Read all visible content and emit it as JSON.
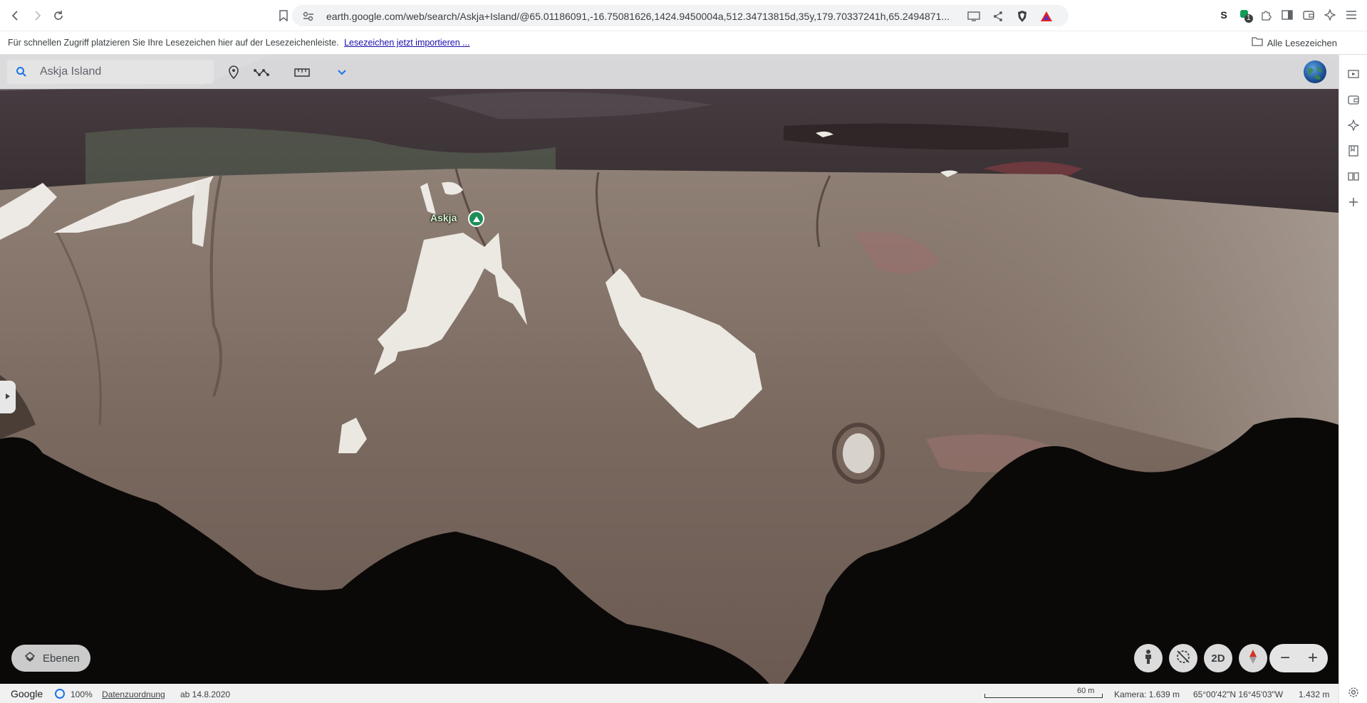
{
  "browser": {
    "url": "earth.google.com/web/search/Askja+Island/@65.01186091,-16.75081626,1424.9450004a,512.34713815d,35y,179.70337241h,65.2494871...",
    "icons": [
      "back-icon",
      "forward-icon",
      "reload-icon",
      "bookmark-icon",
      "site-settings-icon",
      "cast-icon",
      "share-icon",
      "brave-shield-icon",
      "brave-rewards-icon"
    ],
    "extensions": [
      "s-extension-icon",
      "ext-badge-icon",
      "puzzle-icon",
      "sidebar-icon",
      "wallet-icon",
      "leo-icon",
      "menu-icon"
    ],
    "ext_badge": "1"
  },
  "bookmarks_bar": {
    "text": "Für schnellen Zugriff platzieren Sie Ihre Lesezeichen hier auf der Lesezeichenleiste.",
    "link": "Lesezeichen jetzt importieren ...",
    "all_bookmarks": "Alle Lesezeichen"
  },
  "earth": {
    "search_value": "Askja Island",
    "tools": [
      "place-pin-icon",
      "path-icon",
      "ruler-icon",
      "chevron-down-icon"
    ],
    "place_label": "Askja",
    "layers_label": "Ebenen",
    "view_2d": "2D",
    "zoom_out": "−",
    "zoom_in": "+"
  },
  "status": {
    "brand": "Google",
    "percent": "100%",
    "attribution": "Datenzuordnung",
    "date": "ab 14.8.2020",
    "scale": "60 m",
    "camera": "Kamera: 1.639 m",
    "coords": "65°00'42\"N 16°45'03\"W",
    "altitude": "1.432 m"
  }
}
